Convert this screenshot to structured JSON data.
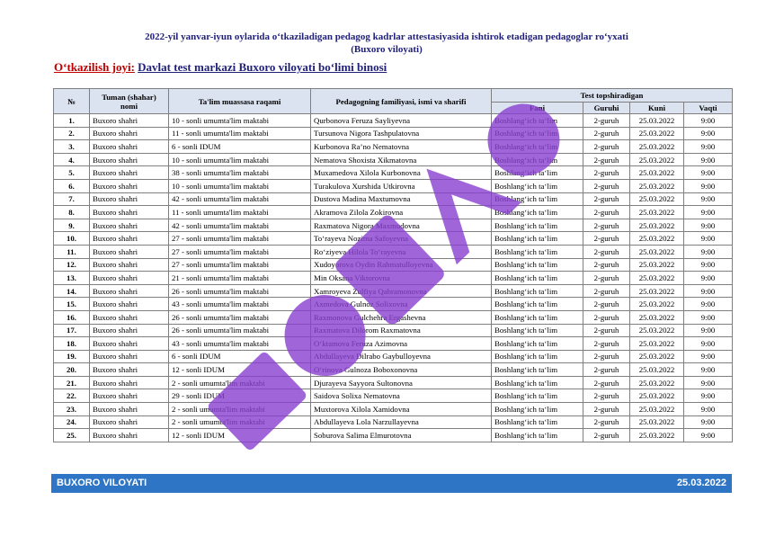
{
  "header": {
    "title_line1": "2022-yil yanvar-iyun oylarida o‘tkaziladigan pedagog kadrlar attestasiyasida  ishtirok etadigan pedagoglar ro‘yxati",
    "title_line2": "(Buxoro viloyati)",
    "venue_label": "O‘tkazilish joyi:",
    "venue_value": "Davlat test markazi Buxoro viloyati bo‘limi binosi"
  },
  "table": {
    "headers": {
      "no": "№",
      "district": "Tuman (shahar) nomi",
      "school": "Ta'lim muassasa raqami",
      "name": "Pedagogning familiyasi, ismi va sharifi",
      "test_group": "Test topshiradigan",
      "subject": "Fani",
      "group": "Guruhi",
      "day": "Kuni",
      "time": "Vaqti"
    },
    "rows": [
      {
        "no": "1.",
        "district": "Buxoro shahri",
        "school": "10 - sonli umumta'lim maktabi",
        "name": "Qurbonova Feruza Sayliyevna",
        "subject": "Boshlang‘ich ta‘lim",
        "group": "2-guruh",
        "day": "25.03.2022",
        "time": "9:00"
      },
      {
        "no": "2.",
        "district": "Buxoro shahri",
        "school": "11 - sonli umumta'lim maktabi",
        "name": "Tursunova Nigora Tashpulatovna",
        "subject": "Boshlang‘ich ta‘lim",
        "group": "2-guruh",
        "day": "25.03.2022",
        "time": "9:00"
      },
      {
        "no": "3.",
        "district": "Buxoro shahri",
        "school": "6 - sonli IDUM",
        "name": "Kurbonova Ra’no Nematovna",
        "subject": "Boshlang‘ich ta‘lim",
        "group": "2-guruh",
        "day": "25.03.2022",
        "time": "9:00"
      },
      {
        "no": "4.",
        "district": "Buxoro shahri",
        "school": "10 - sonli umumta'lim maktabi",
        "name": "Nematova Shoxista Xikmatovna",
        "subject": "Boshlang‘ich ta‘lim",
        "group": "2-guruh",
        "day": "25.03.2022",
        "time": "9:00"
      },
      {
        "no": "5.",
        "district": "Buxoro shahri",
        "school": "38 - sonli umumta'lim maktabi",
        "name": "Muxamedova Xilola Kurbonovna",
        "subject": "Boshlang‘ich ta‘lim",
        "group": "2-guruh",
        "day": "25.03.2022",
        "time": "9:00"
      },
      {
        "no": "6.",
        "district": "Buxoro shahri",
        "school": "10 - sonli umumta'lim maktabi",
        "name": "Turakulova Xurshida Utkirovna",
        "subject": "Boshlang‘ich ta‘lim",
        "group": "2-guruh",
        "day": "25.03.2022",
        "time": "9:00"
      },
      {
        "no": "7.",
        "district": "Buxoro shahri",
        "school": "42 - sonli umumta'lim maktabi",
        "name": "Dustova Madina Maxtumovna",
        "subject": "Boshlang‘ich ta‘lim",
        "group": "2-guruh",
        "day": "25.03.2022",
        "time": "9:00"
      },
      {
        "no": "8.",
        "district": "Buxoro shahri",
        "school": "11 - sonli umumta'lim maktabi",
        "name": "Akramova Zilola Zokirovna",
        "subject": "Boshlang‘ich ta‘lim",
        "group": "2-guruh",
        "day": "25.03.2022",
        "time": "9:00"
      },
      {
        "no": "9.",
        "district": "Buxoro shahri",
        "school": "42 - sonli umumta'lim maktabi",
        "name": "Raxmatova Nigora Maxmudovna",
        "subject": "Boshlang‘ich ta‘lim",
        "group": "2-guruh",
        "day": "25.03.2022",
        "time": "9:00"
      },
      {
        "no": "10.",
        "district": "Buxoro shahri",
        "school": "27 - sonli umumta'lim maktabi",
        "name": "To‘rayeva Nozima Safoyevna",
        "subject": "Boshlang‘ich ta‘lim",
        "group": "2-guruh",
        "day": "25.03.2022",
        "time": "9:00"
      },
      {
        "no": "11.",
        "district": "Buxoro shahri",
        "school": "27 - sonli umumta'lim maktabi",
        "name": "Ro‘ziyeva Hilola To‘rayevna",
        "subject": "Boshlang‘ich ta‘lim",
        "group": "2-guruh",
        "day": "25.03.2022",
        "time": "9:00"
      },
      {
        "no": "12.",
        "district": "Buxoro shahri",
        "school": "27 - sonli umumta'lim maktabi",
        "name": "Xudoyorova Oydin Rahmatulloyevna",
        "subject": "Boshlang‘ich ta‘lim",
        "group": "2-guruh",
        "day": "25.03.2022",
        "time": "9:00"
      },
      {
        "no": "13.",
        "district": "Buxoro shahri",
        "school": "21 - sonli umumta'lim maktabi",
        "name": "Min Oksana Viktorovna",
        "subject": "Boshlang‘ich ta‘lim",
        "group": "2-guruh",
        "day": "25.03.2022",
        "time": "9:00"
      },
      {
        "no": "14.",
        "district": "Buxoro shahri",
        "school": "26 - sonli umumta'lim maktabi",
        "name": "Xamroyeva Zulfiya Qahramonovna",
        "subject": "Boshlang‘ich ta‘lim",
        "group": "2-guruh",
        "day": "25.03.2022",
        "time": "9:00"
      },
      {
        "no": "15.",
        "district": "Buxoro shahri",
        "school": "43 - sonli umumta'lim maktabi",
        "name": "Axmedova Gulnoz Solixovna",
        "subject": "Boshlang‘ich ta‘lim",
        "group": "2-guruh",
        "day": "25.03.2022",
        "time": "9:00"
      },
      {
        "no": "16.",
        "district": "Buxoro shahri",
        "school": "26 - sonli umumta'lim maktabi",
        "name": "Raxmonova Gulchehra Ergashevna",
        "subject": "Boshlang‘ich ta‘lim",
        "group": "2-guruh",
        "day": "25.03.2022",
        "time": "9:00"
      },
      {
        "no": "17.",
        "district": "Buxoro shahri",
        "school": "26 - sonli umumta'lim maktabi",
        "name": "Raxmatova Dilorom Raxmatovna",
        "subject": "Boshlang‘ich ta‘lim",
        "group": "2-guruh",
        "day": "25.03.2022",
        "time": "9:00"
      },
      {
        "no": "18.",
        "district": "Buxoro shahri",
        "school": "43 - sonli umumta'lim maktabi",
        "name": "O‘ktamova Feruza Azimovna",
        "subject": "Boshlang‘ich ta‘lim",
        "group": "2-guruh",
        "day": "25.03.2022",
        "time": "9:00"
      },
      {
        "no": "19.",
        "district": "Buxoro shahri",
        "school": "6 - sonli IDUM",
        "name": "Abdullayeva Dilrabo Gaybulloyevna",
        "subject": "Boshlang‘ich ta‘lim",
        "group": "2-guruh",
        "day": "25.03.2022",
        "time": "9:00"
      },
      {
        "no": "20.",
        "district": "Buxoro shahri",
        "school": "12 - sonli IDUM",
        "name": "O‘rinova Gulnoza Boboxonovna",
        "subject": "Boshlang‘ich ta‘lim",
        "group": "2-guruh",
        "day": "25.03.2022",
        "time": "9:00"
      },
      {
        "no": "21.",
        "district": "Buxoro shahri",
        "school": "2 - sonli umumta'lim maktabi",
        "name": "Djurayeva Sayyora Sultonovna",
        "subject": "Boshlang‘ich ta‘lim",
        "group": "2-guruh",
        "day": "25.03.2022",
        "time": "9:00"
      },
      {
        "no": "22.",
        "district": "Buxoro shahri",
        "school": "29 - sonli IDUM",
        "name": "Saidova Solixa Nematovna",
        "subject": "Boshlang‘ich ta‘lim",
        "group": "2-guruh",
        "day": "25.03.2022",
        "time": "9:00"
      },
      {
        "no": "23.",
        "district": "Buxoro shahri",
        "school": "2 - sonli umumta'lim maktabi",
        "name": "Muxtorova Xilola Xamidovna",
        "subject": "Boshlang‘ich ta‘lim",
        "group": "2-guruh",
        "day": "25.03.2022",
        "time": "9:00"
      },
      {
        "no": "24.",
        "district": "Buxoro shahri",
        "school": "2 - sonli umumta'lim maktabi",
        "name": "Abdullayeva Lola Narzullayevna",
        "subject": "Boshlang‘ich ta‘lim",
        "group": "2-guruh",
        "day": "25.03.2022",
        "time": "9:00"
      },
      {
        "no": "25.",
        "district": "Buxoro shahri",
        "school": "12 - sonli IDUM",
        "name": "Soburova Salima Elmurotovna",
        "subject": "Boshlang‘ich ta‘lim",
        "group": "2-guruh",
        "day": "25.03.2022",
        "time": "9:00"
      }
    ]
  },
  "watermark": {
    "icon": "diagonal-watermark",
    "color": "#8a3fd1"
  },
  "footer": {
    "left": "BUXORO VILOYATI",
    "right": "25.03.2022",
    "background": "#2e75c6"
  }
}
